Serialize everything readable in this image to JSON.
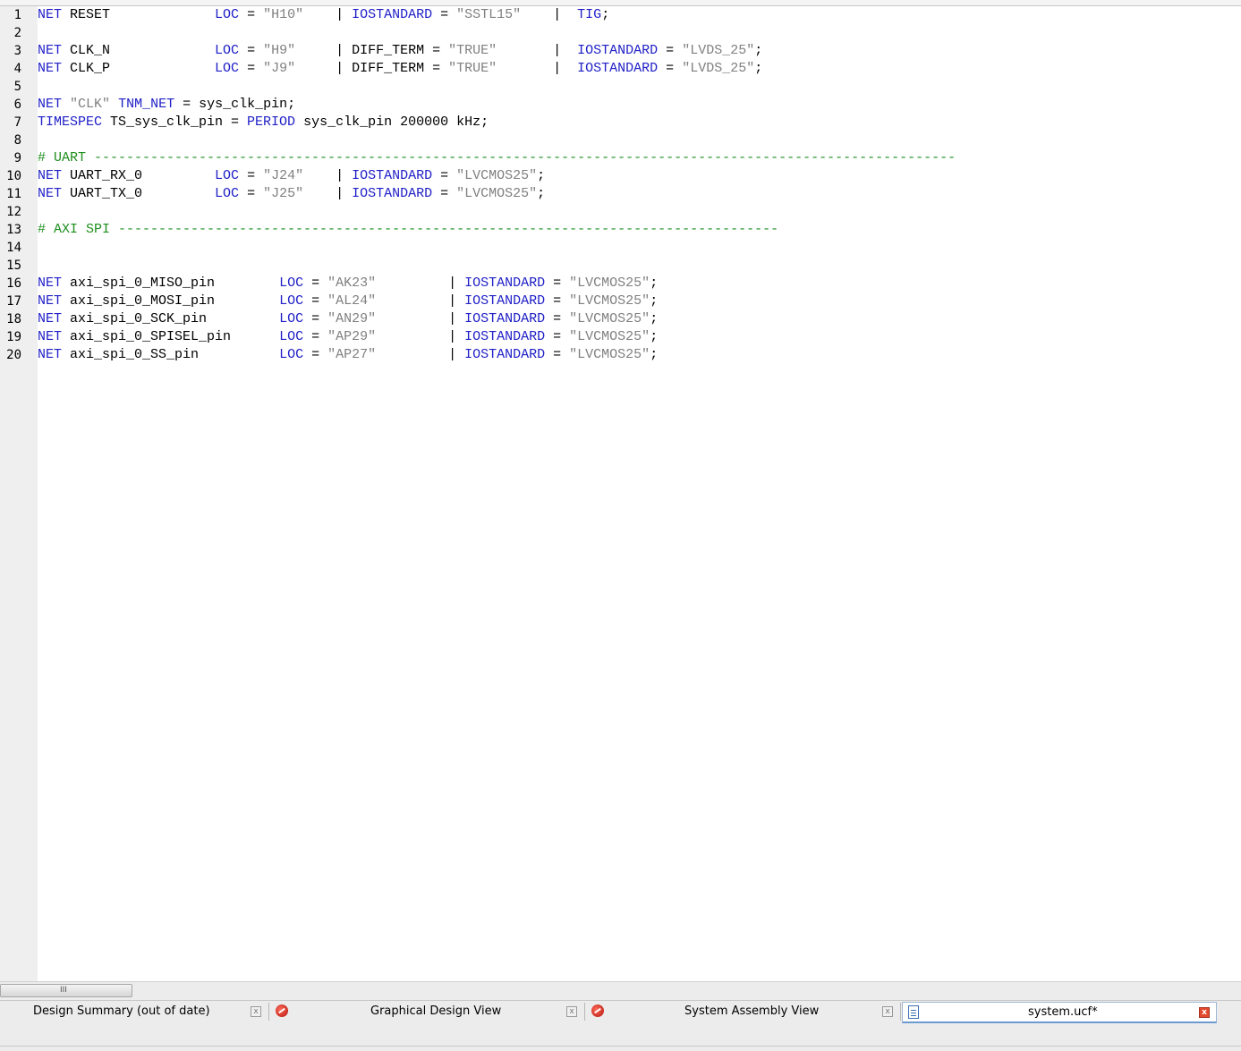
{
  "editor": {
    "lines": [
      {
        "n": "1",
        "tokens": [
          {
            "t": "NET",
            "c": "kw"
          },
          {
            "t": " RESET             "
          },
          {
            "t": "LOC",
            "c": "kw"
          },
          {
            "t": " = "
          },
          {
            "t": "\"H10\"",
            "c": "str"
          },
          {
            "t": "    | "
          },
          {
            "t": "IOSTANDARD",
            "c": "kw"
          },
          {
            "t": " = "
          },
          {
            "t": "\"SSTL15\"",
            "c": "str"
          },
          {
            "t": "    |  "
          },
          {
            "t": "TIG",
            "c": "kw"
          },
          {
            "t": ";"
          }
        ]
      },
      {
        "n": "2",
        "tokens": []
      },
      {
        "n": "3",
        "tokens": [
          {
            "t": "NET",
            "c": "kw"
          },
          {
            "t": " CLK_N             "
          },
          {
            "t": "LOC",
            "c": "kw"
          },
          {
            "t": " = "
          },
          {
            "t": "\"H9\"",
            "c": "str"
          },
          {
            "t": "     | DIFF_TERM = "
          },
          {
            "t": "\"TRUE\"",
            "c": "str"
          },
          {
            "t": "       |  "
          },
          {
            "t": "IOSTANDARD",
            "c": "kw"
          },
          {
            "t": " = "
          },
          {
            "t": "\"LVDS_25\"",
            "c": "str"
          },
          {
            "t": ";"
          }
        ]
      },
      {
        "n": "4",
        "tokens": [
          {
            "t": "NET",
            "c": "kw"
          },
          {
            "t": " CLK_P             "
          },
          {
            "t": "LOC",
            "c": "kw"
          },
          {
            "t": " = "
          },
          {
            "t": "\"J9\"",
            "c": "str"
          },
          {
            "t": "     | DIFF_TERM = "
          },
          {
            "t": "\"TRUE\"",
            "c": "str"
          },
          {
            "t": "       |  "
          },
          {
            "t": "IOSTANDARD",
            "c": "kw"
          },
          {
            "t": " = "
          },
          {
            "t": "\"LVDS_25\"",
            "c": "str"
          },
          {
            "t": ";"
          }
        ]
      },
      {
        "n": "5",
        "tokens": []
      },
      {
        "n": "6",
        "tokens": [
          {
            "t": "NET",
            "c": "kw"
          },
          {
            "t": " "
          },
          {
            "t": "\"CLK\"",
            "c": "str"
          },
          {
            "t": " "
          },
          {
            "t": "TNM_NET",
            "c": "kw"
          },
          {
            "t": " = sys_clk_pin;"
          }
        ]
      },
      {
        "n": "7",
        "tokens": [
          {
            "t": "TIMESPEC",
            "c": "kw"
          },
          {
            "t": " TS_sys_clk_pin = "
          },
          {
            "t": "PERIOD",
            "c": "kw"
          },
          {
            "t": " sys_clk_pin 200000 kHz;"
          }
        ]
      },
      {
        "n": "8",
        "tokens": []
      },
      {
        "n": "9",
        "tokens": [
          {
            "t": "# UART -----------------------------------------------------------------------------------------------------------",
            "c": "cm"
          }
        ]
      },
      {
        "n": "10",
        "tokens": [
          {
            "t": "NET",
            "c": "kw"
          },
          {
            "t": " UART_RX_0         "
          },
          {
            "t": "LOC",
            "c": "kw"
          },
          {
            "t": " = "
          },
          {
            "t": "\"J24\"",
            "c": "str"
          },
          {
            "t": "    | "
          },
          {
            "t": "IOSTANDARD",
            "c": "kw"
          },
          {
            "t": " = "
          },
          {
            "t": "\"LVCMOS25\"",
            "c": "str"
          },
          {
            "t": ";"
          }
        ]
      },
      {
        "n": "11",
        "tokens": [
          {
            "t": "NET",
            "c": "kw"
          },
          {
            "t": " UART_TX_0         "
          },
          {
            "t": "LOC",
            "c": "kw"
          },
          {
            "t": " = "
          },
          {
            "t": "\"J25\"",
            "c": "str"
          },
          {
            "t": "    | "
          },
          {
            "t": "IOSTANDARD",
            "c": "kw"
          },
          {
            "t": " = "
          },
          {
            "t": "\"LVCMOS25\"",
            "c": "str"
          },
          {
            "t": ";"
          }
        ]
      },
      {
        "n": "12",
        "tokens": []
      },
      {
        "n": "13",
        "tokens": [
          {
            "t": "# AXI SPI ----------------------------------------------------------------------------------",
            "c": "cm"
          }
        ]
      },
      {
        "n": "14",
        "tokens": []
      },
      {
        "n": "15",
        "tokens": []
      },
      {
        "n": "16",
        "tokens": [
          {
            "t": "NET",
            "c": "kw"
          },
          {
            "t": " axi_spi_0_MISO_pin        "
          },
          {
            "t": "LOC",
            "c": "kw"
          },
          {
            "t": " = "
          },
          {
            "t": "\"AK23\"",
            "c": "str"
          },
          {
            "t": "         | "
          },
          {
            "t": "IOSTANDARD",
            "c": "kw"
          },
          {
            "t": " = "
          },
          {
            "t": "\"LVCMOS25\"",
            "c": "str"
          },
          {
            "t": ";"
          }
        ]
      },
      {
        "n": "17",
        "tokens": [
          {
            "t": "NET",
            "c": "kw"
          },
          {
            "t": " axi_spi_0_MOSI_pin        "
          },
          {
            "t": "LOC",
            "c": "kw"
          },
          {
            "t": " = "
          },
          {
            "t": "\"AL24\"",
            "c": "str"
          },
          {
            "t": "         | "
          },
          {
            "t": "IOSTANDARD",
            "c": "kw"
          },
          {
            "t": " = "
          },
          {
            "t": "\"LVCMOS25\"",
            "c": "str"
          },
          {
            "t": ";"
          }
        ]
      },
      {
        "n": "18",
        "tokens": [
          {
            "t": "NET",
            "c": "kw"
          },
          {
            "t": " axi_spi_0_SCK_pin         "
          },
          {
            "t": "LOC",
            "c": "kw"
          },
          {
            "t": " = "
          },
          {
            "t": "\"AN29\"",
            "c": "str"
          },
          {
            "t": "         | "
          },
          {
            "t": "IOSTANDARD",
            "c": "kw"
          },
          {
            "t": " = "
          },
          {
            "t": "\"LVCMOS25\"",
            "c": "str"
          },
          {
            "t": ";"
          }
        ]
      },
      {
        "n": "19",
        "tokens": [
          {
            "t": "NET",
            "c": "kw"
          },
          {
            "t": " axi_spi_0_SPISEL_pin      "
          },
          {
            "t": "LOC",
            "c": "kw"
          },
          {
            "t": " = "
          },
          {
            "t": "\"AP29\"",
            "c": "str"
          },
          {
            "t": "         | "
          },
          {
            "t": "IOSTANDARD",
            "c": "kw"
          },
          {
            "t": " = "
          },
          {
            "t": "\"LVCMOS25\"",
            "c": "str"
          },
          {
            "t": ";"
          }
        ]
      },
      {
        "n": "20",
        "tokens": [
          {
            "t": "NET",
            "c": "kw"
          },
          {
            "t": " axi_spi_0_SS_pin          "
          },
          {
            "t": "LOC",
            "c": "kw"
          },
          {
            "t": " = "
          },
          {
            "t": "\"AP27\"",
            "c": "str"
          },
          {
            "t": "         | "
          },
          {
            "t": "IOSTANDARD",
            "c": "kw"
          },
          {
            "t": " = "
          },
          {
            "t": "\"LVCMOS25\"",
            "c": "str"
          },
          {
            "t": ";"
          }
        ]
      }
    ],
    "syntax_colors": {
      "keyword": "#2020c8",
      "string": "#808080",
      "comment": "#1f8f1f"
    }
  },
  "scrollbar": {
    "grip": "III"
  },
  "tabs": [
    {
      "label": "Design Summary (out of date)",
      "icon": "none"
    },
    {
      "label": "Graphical Design View",
      "icon": "xps-app-icon"
    },
    {
      "label": "System Assembly View",
      "icon": "xps-app-icon"
    },
    {
      "label": "system.ucf*",
      "icon": "document-icon",
      "active": true
    }
  ],
  "tab_close_glyph": "x"
}
